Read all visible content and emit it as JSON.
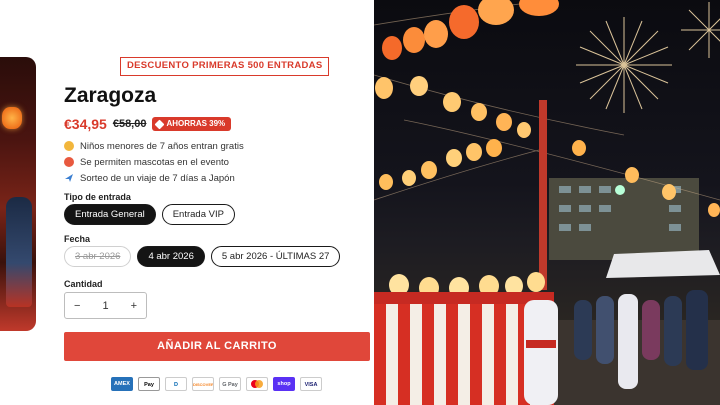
{
  "product": {
    "promo_badge": "DESCUENTO PRIMERAS 500 ENTRADAS",
    "title": "Zaragoza",
    "price_current": "€34,95",
    "price_original": "€58,00",
    "savings_badge": "AHORRAS 39%",
    "features": [
      {
        "icon": "child-icon",
        "text": "Niños menores de 7 años entran gratis"
      },
      {
        "icon": "pet-icon",
        "text": "Se permiten mascotas en el evento"
      },
      {
        "icon": "plane-icon",
        "text": "Sorteo de un viaje de 7 días a Japón"
      }
    ]
  },
  "ticket_type": {
    "label": "Tipo de entrada",
    "options": [
      "Entrada General",
      "Entrada VIP"
    ],
    "selected": "Entrada General"
  },
  "date": {
    "label": "Fecha",
    "options": [
      {
        "text": "3 abr 2026",
        "state": "disabled"
      },
      {
        "text": "4 abr 2026",
        "state": "selected"
      },
      {
        "text": "5 abr 2026 - ÚLTIMAS 27",
        "state": "available"
      }
    ]
  },
  "quantity": {
    "label": "Cantidad",
    "minus": "−",
    "value": "1",
    "plus": "+"
  },
  "cart_button": "AÑADIR AL CARRITO",
  "payment_methods": [
    {
      "name": "AMEX",
      "color": "#2671b9"
    },
    {
      "name": "Pay",
      "color": "#000000"
    },
    {
      "name": "D",
      "color": "#0066b2"
    },
    {
      "name": "DISCOVER",
      "color": "#f58220"
    },
    {
      "name": "G Pay",
      "color": "#5f6368"
    },
    {
      "name": "mastercard",
      "color": "#eb001b"
    },
    {
      "name": "shop",
      "color": "#5a31f4"
    },
    {
      "name": "VISA",
      "color": "#1a1f71"
    }
  ],
  "colors": {
    "accent": "#d93a2b",
    "button": "#e0473a",
    "pill_active": "#141414"
  }
}
